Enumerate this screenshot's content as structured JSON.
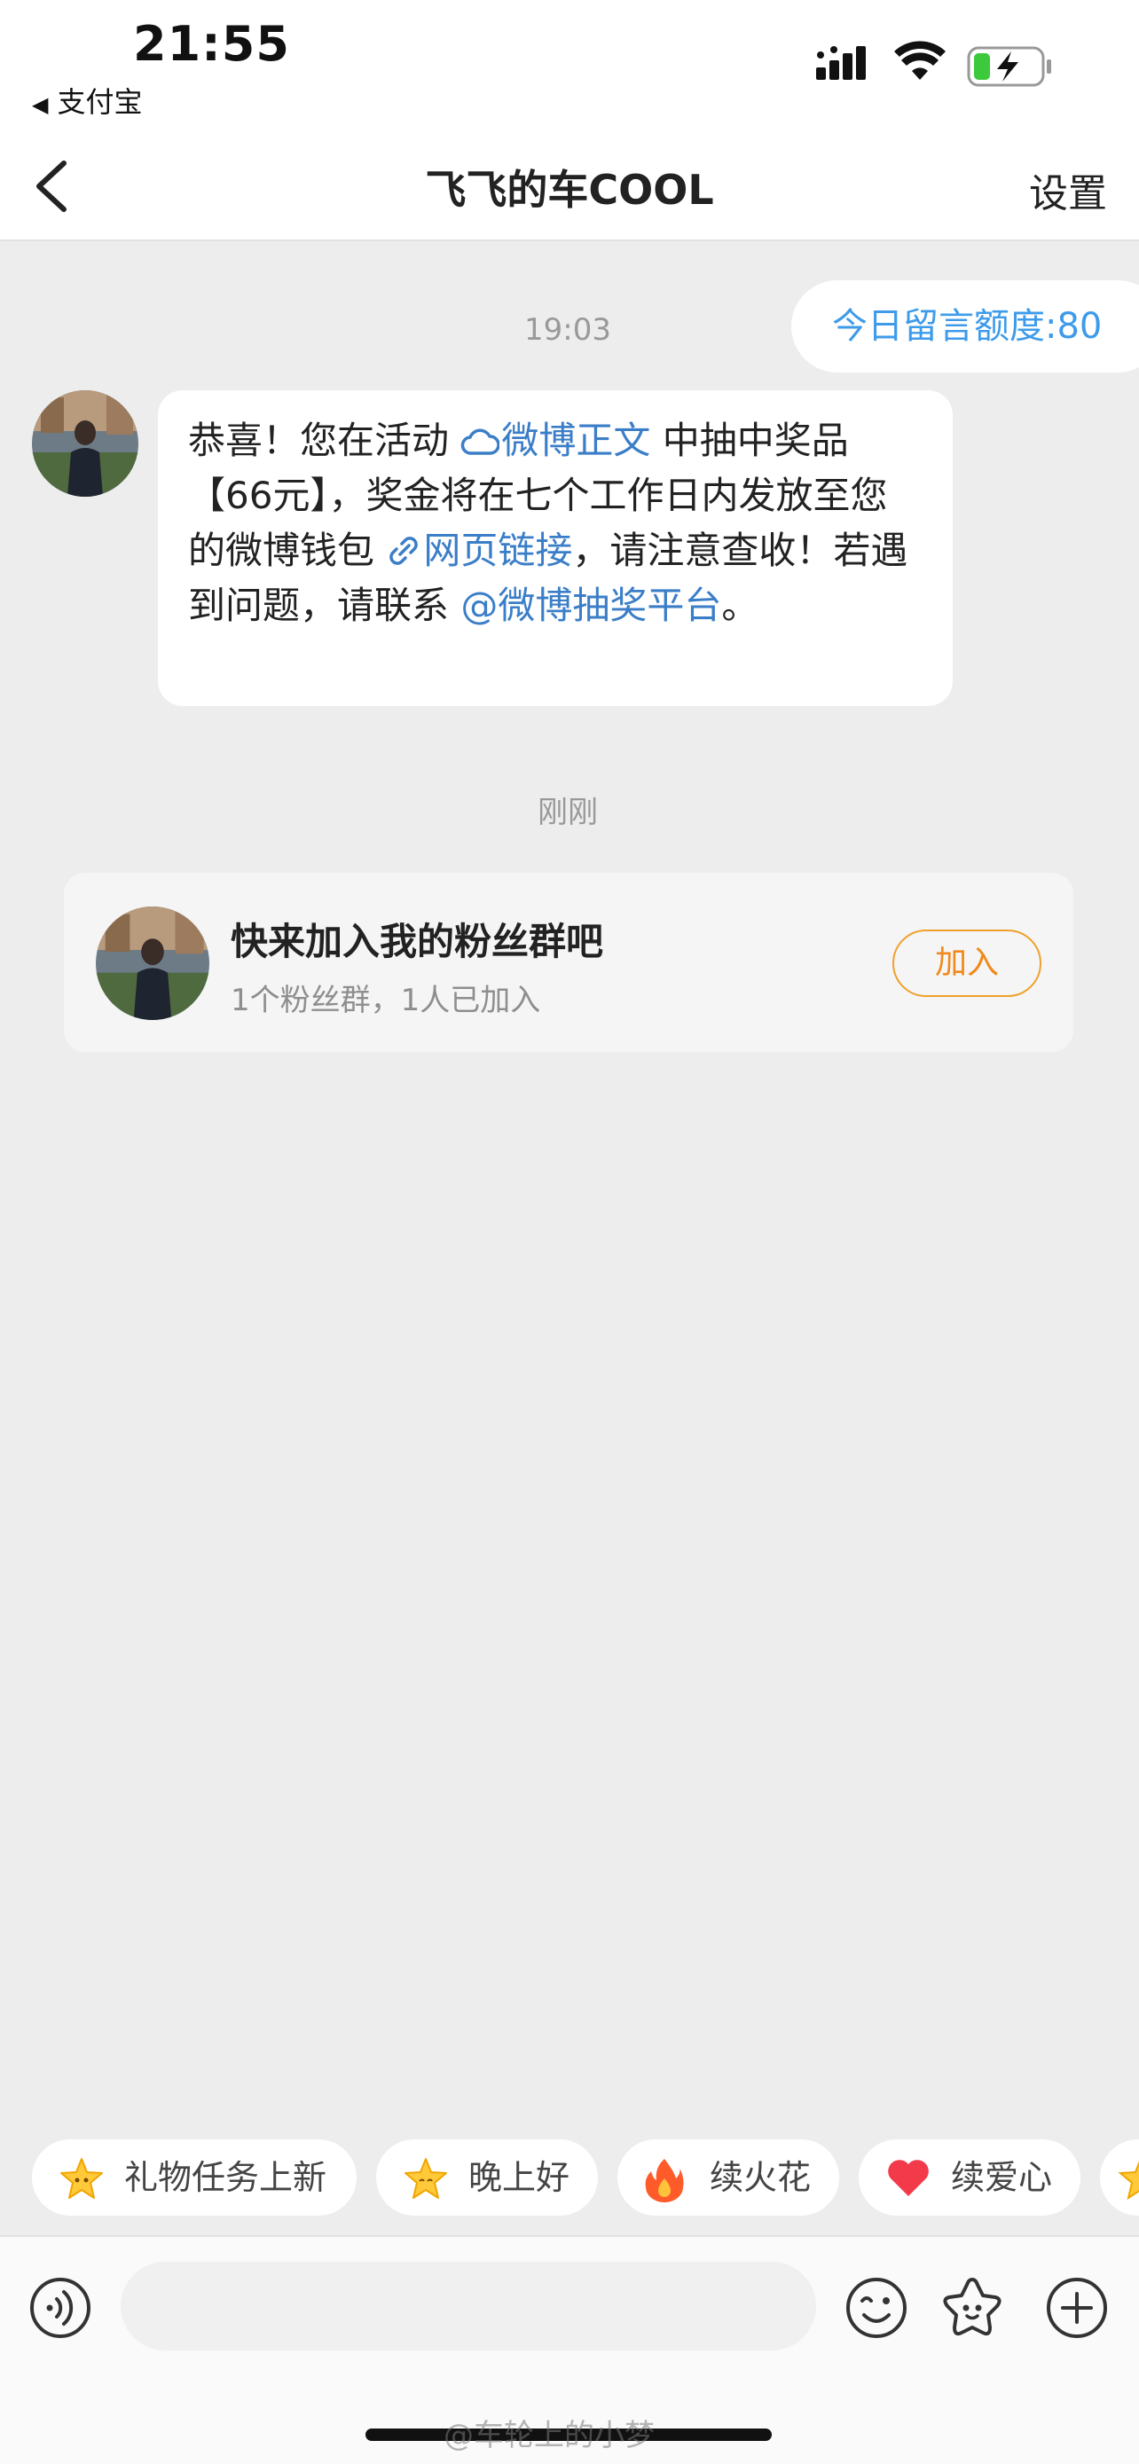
{
  "status_bar": {
    "time": "21:55",
    "back_app": "支付宝"
  },
  "nav": {
    "title": "飞飞的车COOL",
    "settings": "设置"
  },
  "chat": {
    "quota_label": "今日留言额度:80",
    "time_1": "19:03",
    "message": {
      "part1": "恭喜！您在活动 ",
      "link1": "微博正文",
      "part2": " 中抽中奖品【66元】，奖金将在七个工作日内发放至您的微博钱包 ",
      "link2": "网页链接",
      "part3": "，请注意查收！若遇到问题，请联系 ",
      "mention": "@微博抽奖平台",
      "part4": "。"
    },
    "time_2": "刚刚",
    "fan_group": {
      "title": "快来加入我的粉丝群吧",
      "subtitle": "1个粉丝群，1人已加入",
      "join_label": "加入"
    }
  },
  "quick_replies": [
    {
      "label": "礼物任务上新",
      "icon": "star-icon"
    },
    {
      "label": "晚上好",
      "icon": "star-icon"
    },
    {
      "label": "续火花",
      "icon": "fire-icon"
    },
    {
      "label": "续爱心",
      "icon": "heart-icon"
    }
  ],
  "input": {
    "placeholder": ""
  },
  "watermark": "@车轮上的小梦"
}
